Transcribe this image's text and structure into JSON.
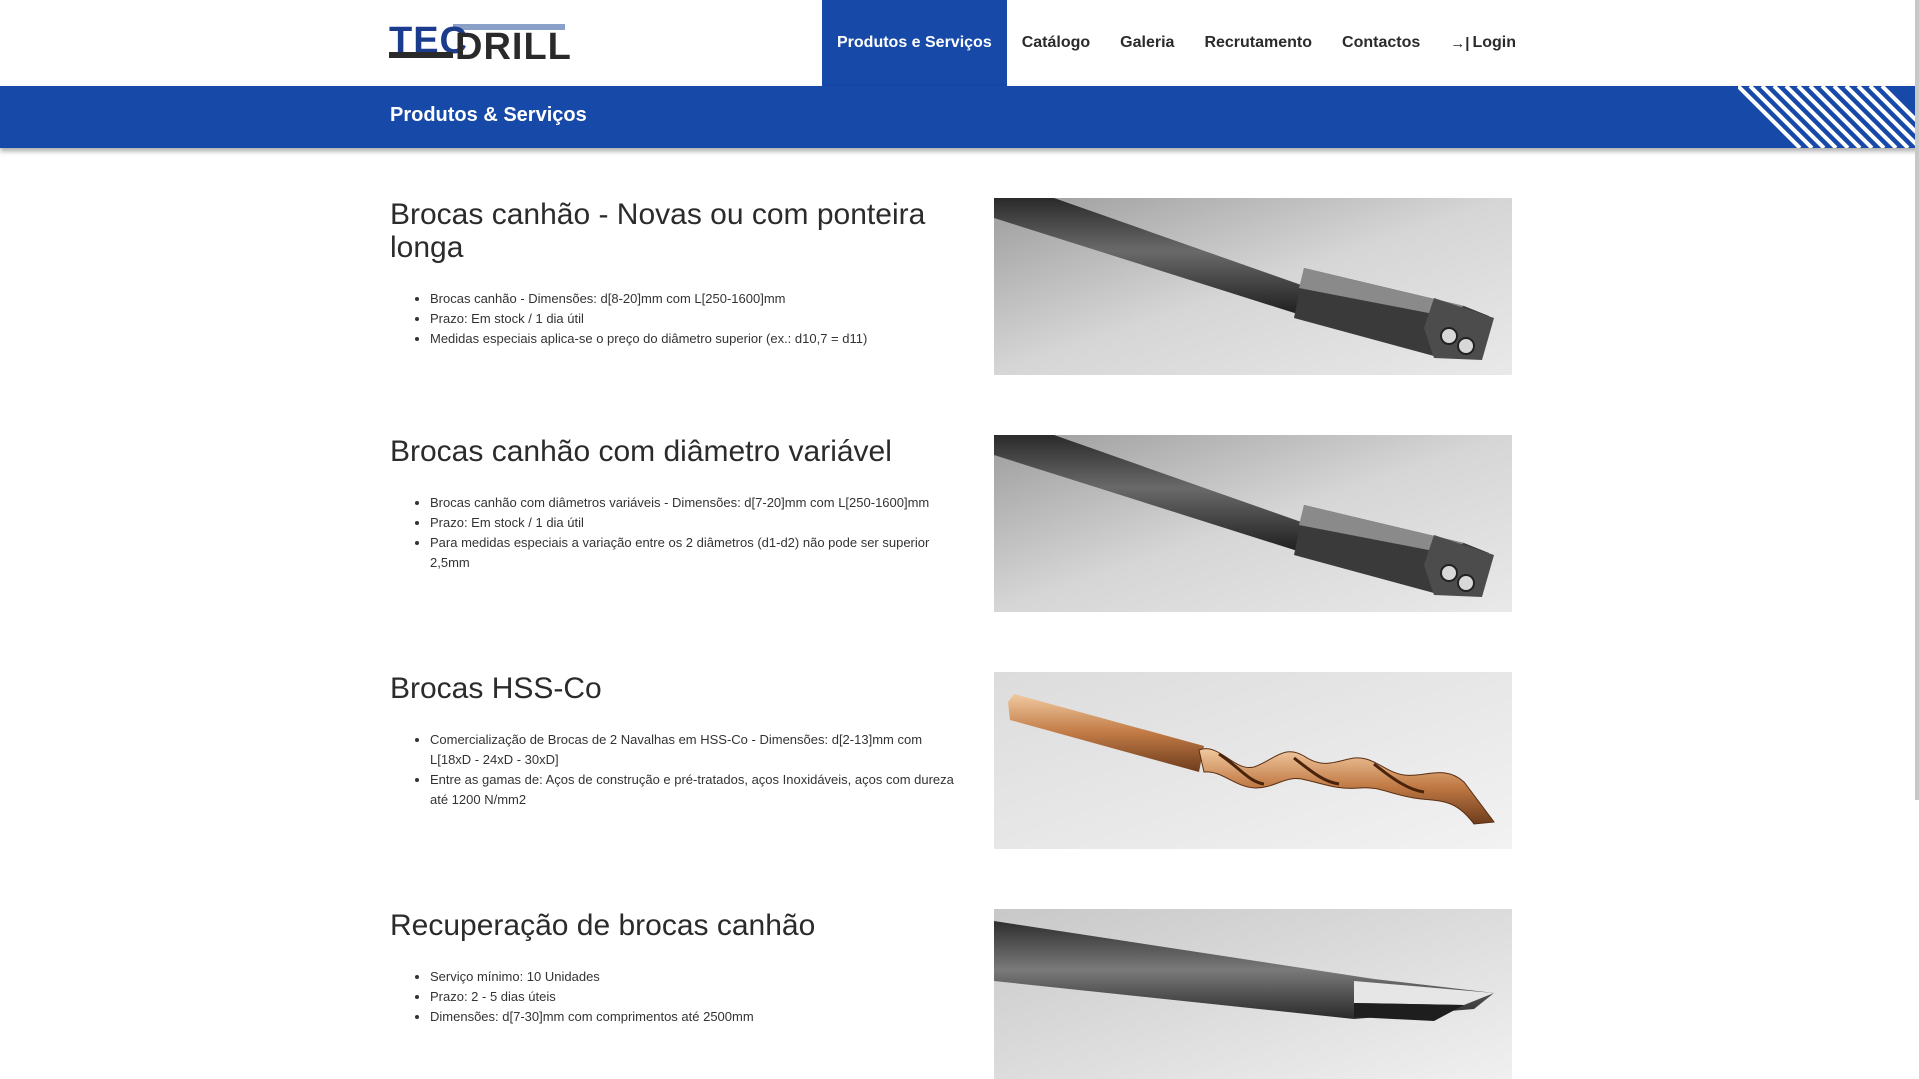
{
  "header": {
    "logo_top": "TEC",
    "logo_bottom": "DRILL",
    "nav": [
      {
        "label": "Produtos e Serviços",
        "active": true
      },
      {
        "label": "Catálogo",
        "active": false
      },
      {
        "label": "Galeria",
        "active": false
      },
      {
        "label": "Recrutamento",
        "active": false
      },
      {
        "label": "Contactos",
        "active": false
      }
    ],
    "login_label": "Login",
    "login_icon": "sign-in-icon"
  },
  "banner": {
    "title": "Produtos & Serviços",
    "color": "#1649a8"
  },
  "sections": [
    {
      "title": "Brocas canhão - Novas ou com ponteira longa",
      "items": [
        "Brocas canhão - Dimensões: d[8-20]mm com L[250-1600]mm",
        "Prazo: Em stock / 1 dia útil",
        "Medidas especiais aplica-se o preço do diâmetro superior (ex.: d10,7 = d11)"
      ],
      "image": "gun-drill-photo"
    },
    {
      "title": "Brocas canhão com diâmetro variável",
      "items": [
        "Brocas canhão com diâmetros variáveis - Dimensões: d[7-20]mm com L[250-1600]mm",
        "Prazo: Em stock / 1 dia útil",
        "Para medidas especiais a variação entre os 2 diâmetros (d1-d2) não pode ser superior 2,5mm"
      ],
      "image": "gun-drill-photo"
    },
    {
      "title": "Brocas HSS-Co",
      "items": [
        "Comercialização de Brocas de 2 Navalhas em HSS-Co - Dimensões: d[2-13]mm com L[18xD - 24xD - 30xD]",
        "Entre as gamas de: Aços de construção e pré-tratados, aços Inoxidáveis, aços com dureza até 1200 N/mm2"
      ],
      "image": "hss-co-drill-photo"
    },
    {
      "title": "Recuperação de brocas canhão",
      "items": [
        "Serviço mínimo: 10 Unidades",
        "Prazo: 2 - 5 dias úteis",
        "Dimensões: d[7-30]mm com comprimentos até 2500mm"
      ],
      "image": "gun-drill-tip-photo"
    }
  ]
}
